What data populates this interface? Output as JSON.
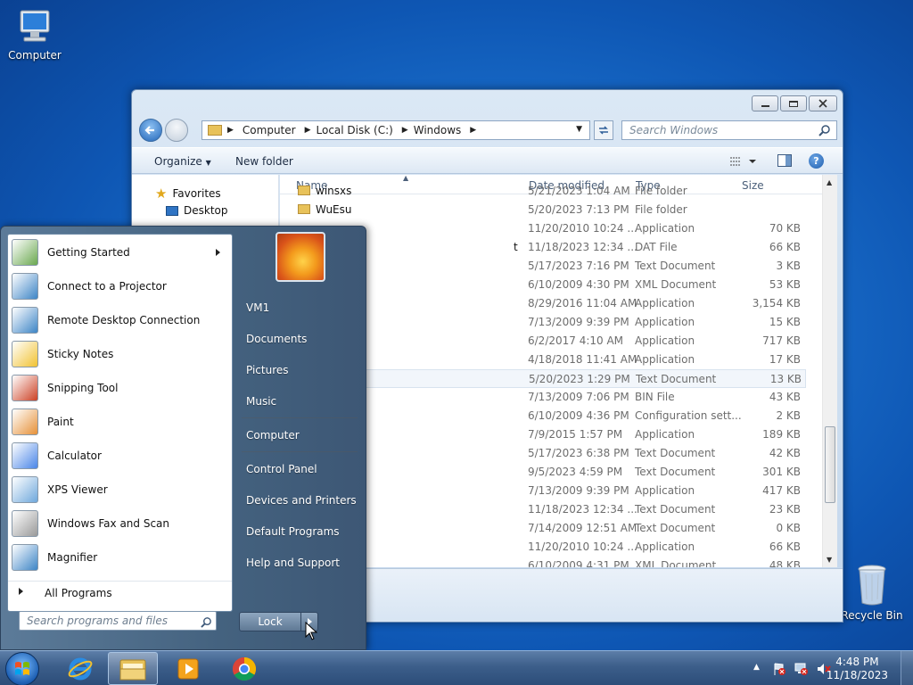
{
  "desktop": {
    "icons": [
      {
        "label": "Computer",
        "icon": "computer-icon"
      },
      {
        "label": "Recycle Bin",
        "icon": "recycle-bin-icon"
      }
    ]
  },
  "explorer": {
    "breadcrumb": [
      "Computer",
      "Local Disk (C:)",
      "Windows"
    ],
    "search_placeholder": "Search Windows",
    "toolbar": {
      "organize": "Organize",
      "new_folder": "New folder"
    },
    "nav_pane": {
      "favorites": "Favorites",
      "desktop": "Desktop"
    },
    "columns": {
      "name": "Name",
      "date": "Date modified",
      "type": "Type",
      "size": "Size"
    },
    "rows": [
      {
        "name": "winsxs",
        "date": "5/21/2023 1:04 AM",
        "type": "File folder",
        "size": ""
      },
      {
        "name": "WuEsu",
        "date": "5/20/2023 7:13 PM",
        "type": "File folder",
        "size": ""
      },
      {
        "name": "",
        "date": "11/20/2010 10:24 ...",
        "type": "Application",
        "size": "70 KB"
      },
      {
        "name": "t",
        "date": "11/18/2023 12:34 ...",
        "type": "DAT File",
        "size": "66 KB"
      },
      {
        "name": "",
        "date": "5/17/2023 7:16 PM",
        "type": "Text Document",
        "size": "3 KB"
      },
      {
        "name": "",
        "date": "6/10/2009 4:30 PM",
        "type": "XML Document",
        "size": "53 KB"
      },
      {
        "name": "",
        "date": "8/29/2016 11:04 AM",
        "type": "Application",
        "size": "3,154 KB"
      },
      {
        "name": "",
        "date": "7/13/2009 9:39 PM",
        "type": "Application",
        "size": "15 KB"
      },
      {
        "name": "",
        "date": "6/2/2017 4:10 AM",
        "type": "Application",
        "size": "717 KB"
      },
      {
        "name": "",
        "date": "4/18/2018 11:41 AM",
        "type": "Application",
        "size": "17 KB"
      },
      {
        "name": "",
        "date": "5/20/2023 1:29 PM",
        "type": "Text Document",
        "size": "13 KB"
      },
      {
        "name": "",
        "date": "7/13/2009 7:06 PM",
        "type": "BIN File",
        "size": "43 KB"
      },
      {
        "name": "",
        "date": "6/10/2009 4:36 PM",
        "type": "Configuration sett...",
        "size": "2 KB"
      },
      {
        "name": "",
        "date": "7/9/2015 1:57 PM",
        "type": "Application",
        "size": "189 KB"
      },
      {
        "name": "",
        "date": "5/17/2023 6:38 PM",
        "type": "Text Document",
        "size": "42 KB"
      },
      {
        "name": "",
        "date": "9/5/2023 4:59 PM",
        "type": "Text Document",
        "size": "301 KB"
      },
      {
        "name": "",
        "date": "7/13/2009 9:39 PM",
        "type": "Application",
        "size": "417 KB"
      },
      {
        "name": "",
        "date": "11/18/2023 12:34 ...",
        "type": "Text Document",
        "size": "23 KB"
      },
      {
        "name": "",
        "date": "7/14/2009 12:51 AM",
        "type": "Text Document",
        "size": "0 KB"
      },
      {
        "name": "",
        "date": "11/20/2010 10:24 ...",
        "type": "Application",
        "size": "66 KB"
      },
      {
        "name": "",
        "date": "6/10/2009 4:31 PM",
        "type": "XML Document",
        "size": "48 KB"
      }
    ]
  },
  "start_menu": {
    "programs": [
      {
        "label": "Getting Started",
        "has_arrow": true
      },
      {
        "label": "Connect to a Projector"
      },
      {
        "label": "Remote Desktop Connection"
      },
      {
        "label": "Sticky Notes"
      },
      {
        "label": "Snipping Tool"
      },
      {
        "label": "Paint"
      },
      {
        "label": "Calculator"
      },
      {
        "label": "XPS Viewer"
      },
      {
        "label": "Windows Fax and Scan"
      },
      {
        "label": "Magnifier"
      }
    ],
    "all_programs": "All Programs",
    "search_placeholder": "Search programs and files",
    "right_items": [
      "VM1",
      "Documents",
      "Pictures",
      "Music",
      "Computer",
      "Control Panel",
      "Devices and Printers",
      "Default Programs",
      "Help and Support"
    ],
    "lock_label": "Lock"
  },
  "taskbar": {
    "time": "4:48 PM",
    "date": "11/18/2023"
  }
}
